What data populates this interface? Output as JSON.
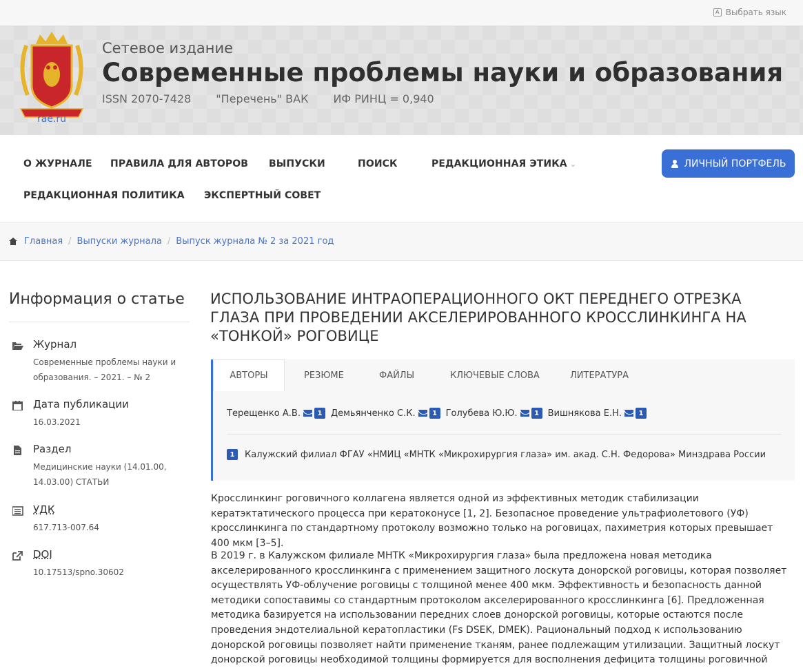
{
  "topbar": {
    "lang_label": "Выбрать язык",
    "lang_icon": "language-icon"
  },
  "header": {
    "logo_link": "rae.ru",
    "logo_motto": "LABORE ET SCIENTIA",
    "pre_title": "Сетевое издание",
    "title": "Современные проблемы науки и образования",
    "meta": [
      "ISSN 2070-7428",
      "\"Перечень\" ВАК",
      "ИФ РИНЦ = 0,940"
    ],
    "colors": {
      "logo_red": "#c8262b",
      "logo_gold": "#e6b42a"
    }
  },
  "nav": {
    "items": [
      "О ЖУРНАЛЕ",
      "ПРАВИЛА ДЛЯ АВТОРОВ",
      "ВЫПУСКИ",
      "ПОИСК",
      "РЕДАКЦИОННАЯ ЭТИКА",
      "РЕДАКЦИОННАЯ ПОЛИТИКА",
      "ЭКСПЕРТНЫЙ СОВЕТ"
    ],
    "portfolio_button": "ЛИЧНЫЙ ПОРТФЕЛЬ",
    "accent": "#3a70d6"
  },
  "breadcrumb": [
    "Главная",
    "Выпуски журнала",
    "Выпуск журнала № 2 за 2021 год"
  ],
  "sidebar": {
    "title": "Информация о статье",
    "items": [
      {
        "icon": "folder-open-icon",
        "label": "Журнал",
        "value": "Современные проблемы науки и образования. – 2021. – № 2"
      },
      {
        "icon": "calendar-icon",
        "label": "Дата публикации",
        "value": "16.03.2021"
      },
      {
        "icon": "file-icon",
        "label": "Раздел",
        "value": "Медицинские науки (14.01.00, 14.03.00) СТАТЬИ"
      },
      {
        "icon": "list-icon",
        "label": "УДК",
        "value": "617.713-007.64"
      },
      {
        "icon": "external-link-icon",
        "label": "DOI",
        "value": "10.17513/spno.30602"
      }
    ]
  },
  "article": {
    "title": "ИСПОЛЬЗОВАНИЕ ИНТРАОПЕРАЦИОННОГО ОКТ ПЕРЕДНЕГО ОТРЕЗКА ГЛАЗА ПРИ ПРОВЕДЕНИИ АКСЕЛЕРИРОВАННОГО КРОССЛИНКИНГА НА «ТОНКОЙ» РОГОВИЦЕ",
    "tabs": [
      "АВТОРЫ",
      "РЕЗЮМЕ",
      "ФАЙЛЫ",
      "КЛЮЧЕВЫЕ СЛОВА",
      "ЛИТЕРАТУРА"
    ],
    "active_tab": "АВТОРЫ",
    "authors": [
      {
        "name": "Терещенко А.В.",
        "affil": "1"
      },
      {
        "name": "Демьянченко С.К.",
        "affil": "1"
      },
      {
        "name": "Голубева Ю.Ю.",
        "affil": "1"
      },
      {
        "name": "Вишнякова Е.Н.",
        "affil": "1"
      }
    ],
    "affiliation": {
      "num": "1",
      "text": "Калужский филиал ФГАУ «НМИЦ «МНТК «Микрохирургия глаза» им. акад. С.Н. Федорова» Минздрава России"
    },
    "paragraphs": [
      "Кросслинкинг роговичного коллагена является одной из эффективных методик стабилизации кератэктатического процесса при кератоконусе [1, 2].  Безопасное проведение ультрафиолетового (УФ) кросслинкинга по стандартному протоколу возможно только на роговицах, пахиметрия которых превышает 400 мкм [3–5].",
      "В 2019 г. в Калужском филиале МНТК «Микрохирургия глаза» была предложена новая методика акселерированного кросслинкинга с применением защитного лоскута донорской роговицы, которая позволяет осуществлять УФ-облучение роговицы с толщиной менее 400 мкм. Эффективность и безопасность данной методики сопоставимы со стандартным протоколом акселерированного кросслинкинга [6]. Предложенная методика базируется на использовании передних слоев донорской роговицы, которые остаются после проведения эндотелиальной кератопластики (Fs DSEK, DMEK). Рациональный подход к использованию донорской роговицы позволяет найти применение тканям, ранее подлежащим утилизации. Защитный лоскут донорской роговицы необходимой толщины формируется для восполнения дефицита толщины роговичной ткани пациента при помощи фемтосекундного лазера."
    ]
  }
}
